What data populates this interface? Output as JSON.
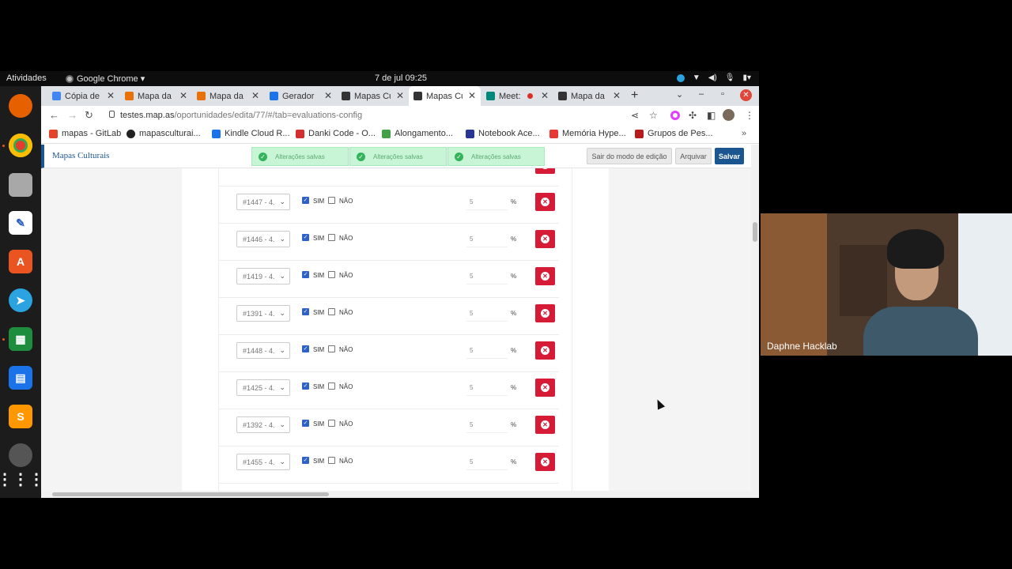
{
  "os_bar": {
    "activities": "Atividades",
    "app_name": "Google Chrome ▾",
    "clock": "7 de jul  09:25"
  },
  "tabs": [
    {
      "label": "Cópia de",
      "icon": "docs-icon",
      "color": "#4285f4"
    },
    {
      "label": "Mapa da",
      "icon": "mapas-icon",
      "color": "#e8710a"
    },
    {
      "label": "Mapa da",
      "icon": "mapas-icon",
      "color": "#e8710a"
    },
    {
      "label": "Gerador",
      "icon": "gerador-icon",
      "color": "#1a73e8"
    },
    {
      "label": "Mapas Cu",
      "icon": "mc-icon",
      "color": "#333333"
    },
    {
      "label": "Mapas Cu",
      "icon": "mc-icon",
      "color": "#333333"
    },
    {
      "label": "Meet:",
      "icon": "meet-icon",
      "color": "#00897b"
    },
    {
      "label": "Mapa da",
      "icon": "mc-icon",
      "color": "#333333"
    }
  ],
  "address": {
    "host": "testes.map.as",
    "path": "/oportunidades/edita/77/#/tab=evaluations-config"
  },
  "bookmarks": [
    {
      "label": "mapas - GitLab",
      "icon": "gitlab-icon",
      "color": "#e24329"
    },
    {
      "label": "mapasculturai...",
      "icon": "github-icon",
      "color": "#222222"
    },
    {
      "label": "Kindle Cloud R...",
      "icon": "kindle-icon",
      "color": "#1a73e8"
    },
    {
      "label": "Danki Code - O...",
      "icon": "code-icon",
      "color": "#d32f2f"
    },
    {
      "label": "Alongamento...",
      "icon": "stretch-icon",
      "color": "#43a047"
    },
    {
      "label": "Notebook Ace...",
      "icon": "notebook-icon",
      "color": "#283593"
    },
    {
      "label": "Memória Hype...",
      "icon": "memoria-icon",
      "color": "#e53935"
    },
    {
      "label": "Grupos de Pes...",
      "icon": "grupos-icon",
      "color": "#b71c1c"
    }
  ],
  "page": {
    "brand": "Mapas Culturais",
    "toasts": [
      "Alterações salvas",
      "Alterações salvas",
      "Alterações salvas"
    ],
    "exit_edit": "Sair do modo de edição",
    "archive": "Arquivar",
    "save": "Salvar",
    "rows": [
      {
        "select": "#1447 - 4.",
        "sim_checked": true,
        "nao_checked": false,
        "percent": "5"
      },
      {
        "select": "#1446 - 4.",
        "sim_checked": true,
        "nao_checked": false,
        "percent": "5"
      },
      {
        "select": "#1419 - 4.",
        "sim_checked": true,
        "nao_checked": false,
        "percent": "5"
      },
      {
        "select": "#1391 - 4.",
        "sim_checked": true,
        "nao_checked": false,
        "percent": "5"
      },
      {
        "select": "#1448 - 4.",
        "sim_checked": true,
        "nao_checked": false,
        "percent": "5"
      },
      {
        "select": "#1425 - 4.",
        "sim_checked": true,
        "nao_checked": false,
        "percent": "5"
      },
      {
        "select": "#1392 - 4.",
        "sim_checked": true,
        "nao_checked": false,
        "percent": "5"
      },
      {
        "select": "#1455 - 4.",
        "sim_checked": true,
        "nao_checked": false,
        "percent": "5"
      }
    ],
    "sim_label": "SIM",
    "nao_label": "NÃO",
    "percent_sign": "%"
  },
  "video_call": {
    "participant": "Daphne Hacklab"
  },
  "colors": {
    "accent": "#1c5690",
    "delete": "#d51b35",
    "toast_bg": "#c9f5d7"
  }
}
